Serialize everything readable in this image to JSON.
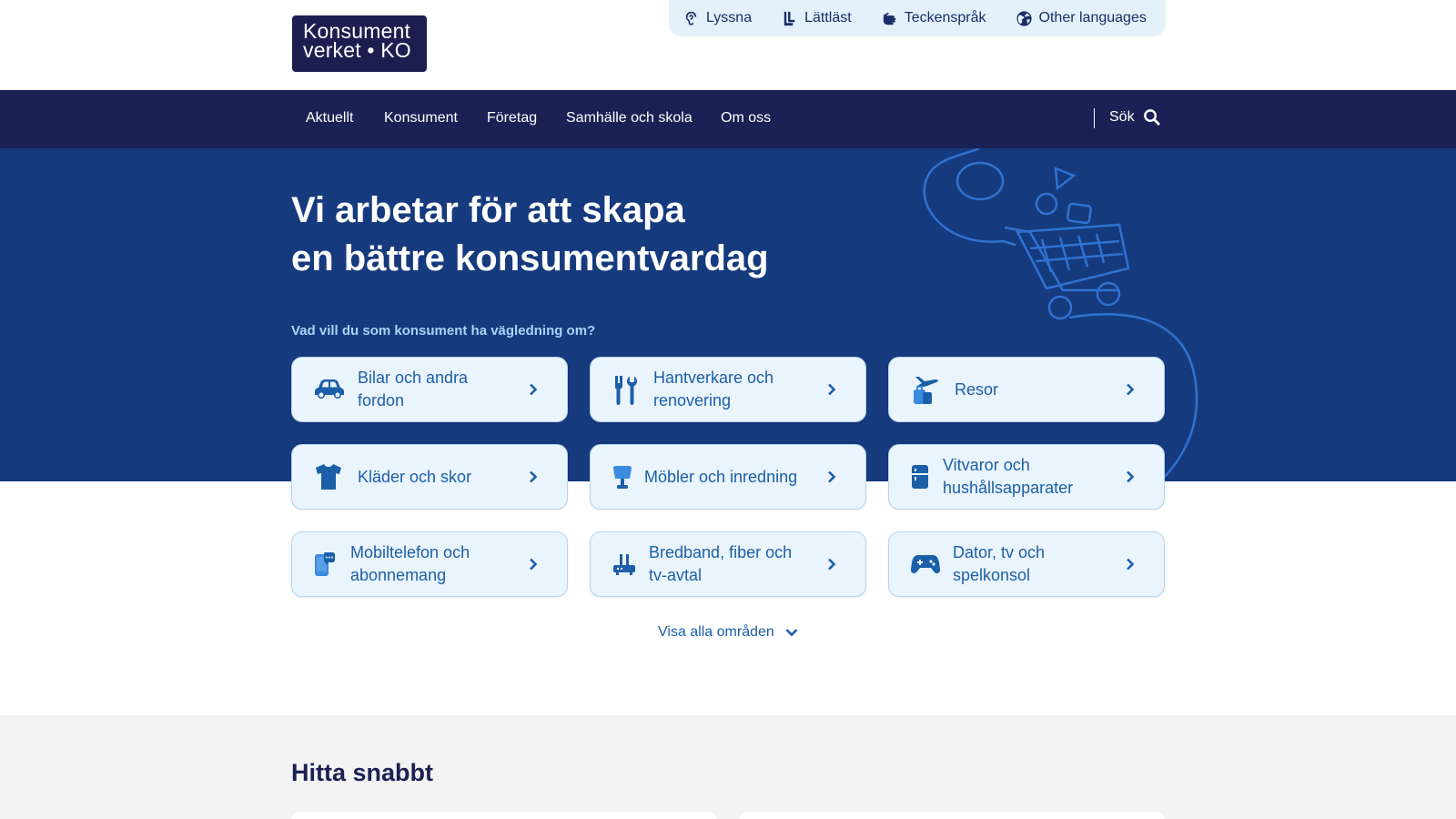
{
  "header": {
    "logo_line1": "Konsument",
    "logo_line2": "verket • KO",
    "access": [
      {
        "label": "Lyssna",
        "icon": "ear-icon"
      },
      {
        "label": "Lättläst",
        "icon": "easy-read-icon"
      },
      {
        "label": "Teckenspråk",
        "icon": "sign-language-icon"
      },
      {
        "label": "Other languages",
        "icon": "globe-icon"
      }
    ]
  },
  "nav": {
    "items": [
      "Aktuellt",
      "Konsument",
      "Företag",
      "Samhälle och skola",
      "Om oss"
    ],
    "search_label": "Sök"
  },
  "hero": {
    "title_line1": "Vi arbetar för att skapa",
    "title_line2": "en bättre konsumentvardag",
    "subtitle": "Vad vill du som konsument ha vägledning om?"
  },
  "cards": [
    {
      "line1": "Bilar och andra",
      "line2": "fordon",
      "icon": "car-icon"
    },
    {
      "line1": "Hantverkare och",
      "line2": "renovering",
      "icon": "tools-icon"
    },
    {
      "line1": "Resor",
      "line2": "",
      "icon": "travel-icon"
    },
    {
      "line1": "Kläder och skor",
      "line2": "",
      "icon": "tshirt-icon"
    },
    {
      "line1": "Möbler och inredning",
      "line2": "",
      "icon": "lamp-icon"
    },
    {
      "line1": "Vitvaror och",
      "line2": "hushållsapparater",
      "icon": "fridge-icon"
    },
    {
      "line1": "Mobiltelefon och",
      "line2": "abonnemang",
      "icon": "phone-icon"
    },
    {
      "line1": "Bredband, fiber och",
      "line2": "tv-avtal",
      "icon": "router-icon"
    },
    {
      "line1": "Dator, tv och",
      "line2": "spelkonsol",
      "icon": "gamepad-icon"
    }
  ],
  "show_all": "Visa alla områden",
  "quick": {
    "title": "Hitta snabbt"
  },
  "colors": {
    "nav_bg": "#1b2154",
    "hero_bg": "#153a7d",
    "card_bg": "#eaf4fc",
    "card_text": "#1b5fa8",
    "access_bg": "#e4f1fb"
  }
}
